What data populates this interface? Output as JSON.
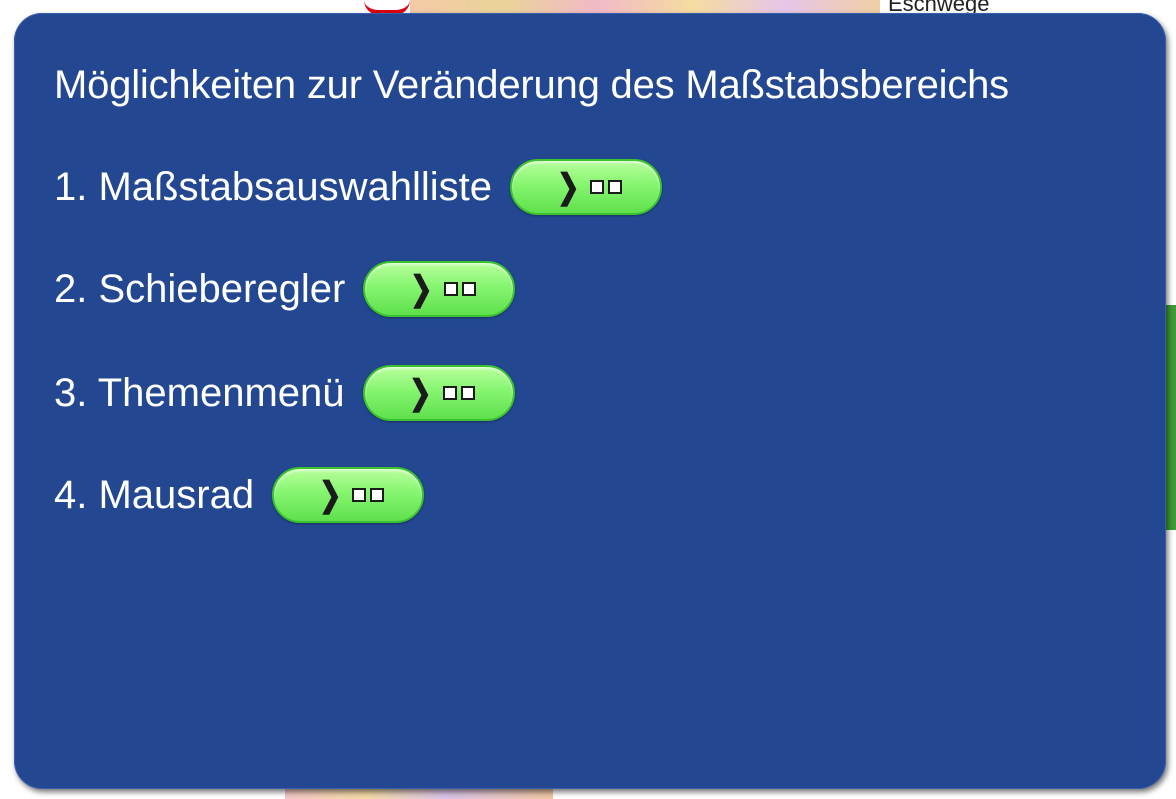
{
  "background": {
    "town_label": "Eschwege"
  },
  "popup": {
    "title": "Möglichkeiten zur Veränderung des Maßstabsbereichs",
    "options": [
      {
        "label": "1. Maßstabsauswahlliste",
        "icon": "chevron-right-icon"
      },
      {
        "label": "2. Schieberegler",
        "icon": "chevron-right-icon"
      },
      {
        "label": "3. Themenmenü",
        "icon": "chevron-right-icon"
      },
      {
        "label": "4. Mausrad",
        "icon": "chevron-right-icon"
      }
    ]
  },
  "colors": {
    "popup_background": "#234891",
    "button_green": "#86f570",
    "text": "#ffffff"
  }
}
